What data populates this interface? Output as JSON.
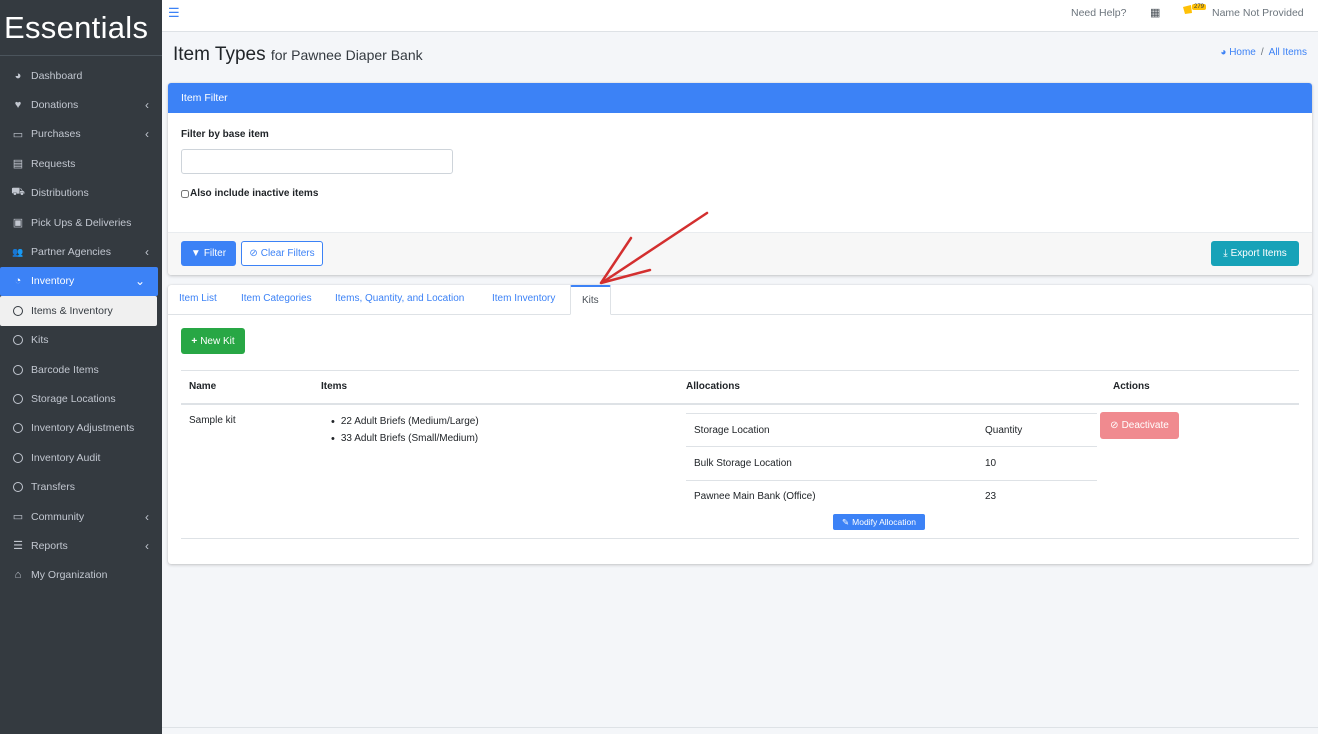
{
  "brand": "Essentials",
  "sidebar": {
    "items": [
      {
        "label": "Dashboard",
        "icon": "dashboard-icon",
        "glyph": "◕",
        "chevron": ""
      },
      {
        "label": "Donations",
        "icon": "heart-icon",
        "glyph": "♥",
        "chevron": "‹"
      },
      {
        "label": "Purchases",
        "icon": "money-icon",
        "glyph": "▭",
        "chevron": "‹"
      },
      {
        "label": "Requests",
        "icon": "file-icon",
        "glyph": "▤",
        "chevron": ""
      },
      {
        "label": "Distributions",
        "icon": "cart-icon",
        "glyph": "⛟",
        "chevron": ""
      },
      {
        "label": "Pick Ups & Deliveries",
        "icon": "calendar-icon",
        "glyph": "▣",
        "chevron": ""
      },
      {
        "label": "Partner Agencies",
        "icon": "users-icon",
        "glyph": "👥",
        "chevron": "‹"
      },
      {
        "label": "Inventory",
        "icon": "pie-chart-icon",
        "glyph": "◔",
        "chevron": "⌄"
      },
      {
        "label": "Items & Inventory",
        "icon": "circle-icon",
        "glyph": "",
        "chevron": ""
      },
      {
        "label": "Kits",
        "icon": "circle-icon",
        "glyph": "",
        "chevron": ""
      },
      {
        "label": "Barcode Items",
        "icon": "circle-icon",
        "glyph": "",
        "chevron": ""
      },
      {
        "label": "Storage Locations",
        "icon": "circle-icon",
        "glyph": "",
        "chevron": ""
      },
      {
        "label": "Inventory Adjustments",
        "icon": "circle-icon",
        "glyph": "",
        "chevron": ""
      },
      {
        "label": "Inventory Audit",
        "icon": "circle-icon",
        "glyph": "",
        "chevron": ""
      },
      {
        "label": "Transfers",
        "icon": "circle-icon",
        "glyph": "",
        "chevron": ""
      },
      {
        "label": "Community",
        "icon": "laptop-icon",
        "glyph": "▭",
        "chevron": "‹"
      },
      {
        "label": "Reports",
        "icon": "list-icon",
        "glyph": "☰",
        "chevron": "‹"
      },
      {
        "label": "My Organization",
        "icon": "home-icon",
        "glyph": "⌂",
        "chevron": ""
      }
    ]
  },
  "topbar": {
    "help": "Need Help?",
    "badge": "279",
    "user": "Name Not Provided"
  },
  "header": {
    "title": "Item Types",
    "subtitle": "for Pawnee Diaper Bank",
    "breadcrumb_home": "Home",
    "breadcrumb_sep": "/",
    "breadcrumb_current": "All Items"
  },
  "filter": {
    "title": "Item Filter",
    "label": "Filter by base item",
    "input_value": "",
    "inactive_label": "Also include inactive items",
    "filter_button": "Filter",
    "clear_button": "Clear Filters",
    "export_button": "Export Items"
  },
  "tabs": [
    "Item List",
    "Item Categories",
    "Items, Quantity, and Location",
    "Item Inventory",
    "Kits"
  ],
  "kits": {
    "new_kit_button": "New Kit",
    "headers": {
      "name": "Name",
      "items": "Items",
      "allocations": "Allocations",
      "actions": "Actions"
    },
    "rows": [
      {
        "name": "Sample kit",
        "items": [
          "22 Adult Briefs (Medium/Large)",
          "33 Adult Briefs (Small/Medium)"
        ],
        "alloc_headers": {
          "location": "Storage Location",
          "quantity": "Quantity"
        },
        "allocations": [
          {
            "location": "Bulk Storage Location",
            "quantity": "10"
          },
          {
            "location": "Pawnee Main Bank (Office)",
            "quantity": "23"
          }
        ],
        "modify_button": "Modify Allocation",
        "deactivate_button": "Deactivate"
      }
    ]
  },
  "colors": {
    "primary": "#3c82f6",
    "sidebar": "#343a40",
    "success": "#28a745",
    "info": "#17a2b8",
    "danger_light": "#f08a8f",
    "annotation_arrow": "#d32f2f"
  }
}
